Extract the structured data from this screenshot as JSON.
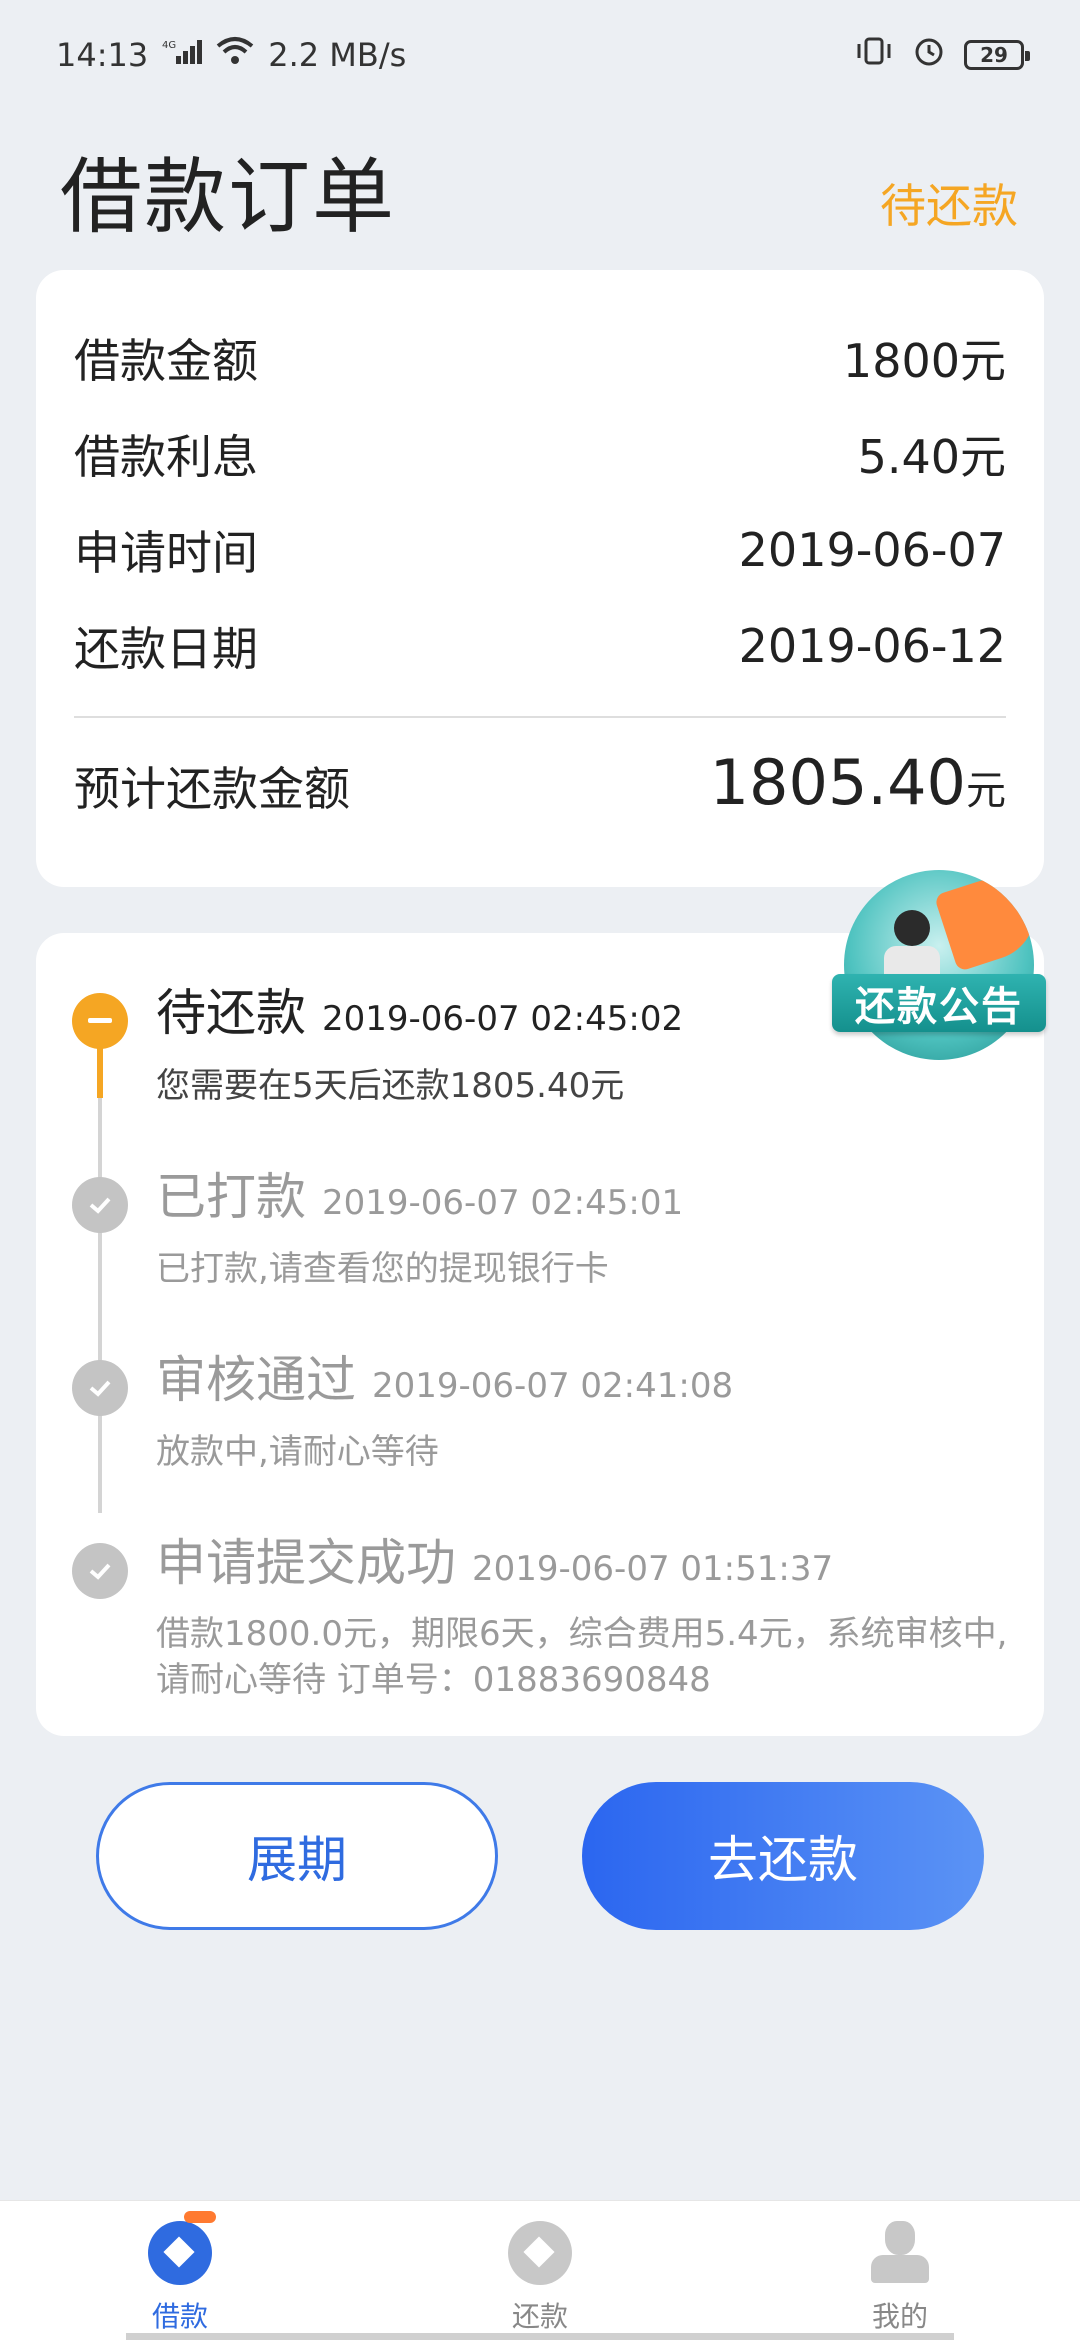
{
  "status_bar": {
    "time": "14:13",
    "network": "4G",
    "speed": "2.2 MB/s",
    "battery": "29"
  },
  "header": {
    "title": "借款订单",
    "status": "待还款"
  },
  "summary": {
    "rows": [
      {
        "label": "借款金额",
        "value": "1800元"
      },
      {
        "label": "借款利息",
        "value": "5.40元"
      },
      {
        "label": "申请时间",
        "value": "2019-06-07"
      },
      {
        "label": "还款日期",
        "value": "2019-06-12"
      }
    ],
    "total_label": "预计还款金额",
    "total_amount": "1805.40",
    "total_unit": "元"
  },
  "timeline": [
    {
      "title": "待还款",
      "time": "2019-06-07 02:45:02",
      "desc": "您需要在5天后还款1805.40元",
      "state": "active"
    },
    {
      "title": "已打款",
      "time": "2019-06-07 02:45:01",
      "desc": "已打款,请查看您的提现银行卡",
      "state": "done"
    },
    {
      "title": "审核通过",
      "time": "2019-06-07 02:41:08",
      "desc": "放款中,请耐心等待",
      "state": "done"
    },
    {
      "title": "申请提交成功",
      "time": "2019-06-07 01:51:37",
      "desc": "借款1800.0元，期限6天，综合费用5.4元，系统审核中,请耐心等待 订单号：01883690848",
      "state": "done"
    }
  ],
  "announcement": {
    "label": "还款公告"
  },
  "buttons": {
    "extend": "展期",
    "repay": "去还款"
  },
  "nav": {
    "items": [
      {
        "label": "借款",
        "icon": "loan-icon",
        "active": true
      },
      {
        "label": "还款",
        "icon": "repay-icon",
        "active": false
      },
      {
        "label": "我的",
        "icon": "profile-icon",
        "active": false
      }
    ]
  },
  "colors": {
    "accent": "#2f6be0",
    "pending": "#f5a623",
    "background": "#eceff3"
  }
}
